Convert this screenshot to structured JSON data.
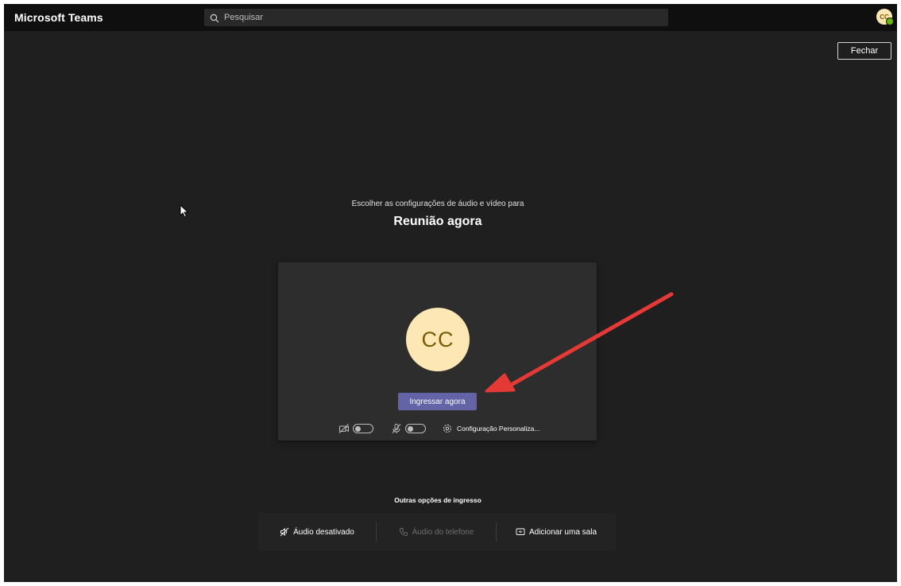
{
  "app": {
    "title": "Microsoft Teams",
    "search_placeholder": "Pesquisar",
    "user_initials": "CC",
    "close_label": "Fechar"
  },
  "prejoin": {
    "subtitle": "Escolher as configurações de áudio e vídeo para",
    "meeting_title": "Reunião agora",
    "avatar_initials": "CC",
    "join_label": "Ingressar agora",
    "camera_on": false,
    "mic_on": false,
    "settings_label": "Configuração Personaliza..."
  },
  "other_options": {
    "title": "Outras opções de ingresso",
    "items": [
      {
        "label": "Áudio desativado",
        "icon": "speaker-off-icon",
        "enabled": true
      },
      {
        "label": "Áudio do telefone",
        "icon": "phone-icon",
        "enabled": false
      },
      {
        "label": "Adicionar uma sala",
        "icon": "room-icon",
        "enabled": true
      }
    ]
  },
  "colors": {
    "background": "#1f1f1f",
    "titlebar": "#0f0f0f",
    "accent": "#6264a7",
    "avatar": "#fde7b4",
    "annotation_arrow": "#e53935"
  }
}
